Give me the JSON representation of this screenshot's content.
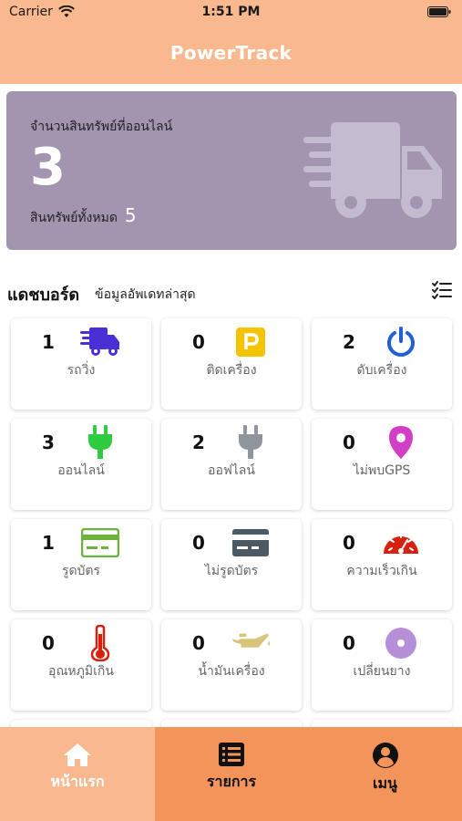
{
  "status_bar": {
    "carrier": "Carrier",
    "time": "1:51 PM"
  },
  "header": {
    "title": "PowerTrack"
  },
  "summary": {
    "online_label": "จำนวนสินทรัพย์ที่ออนไลน์",
    "online_count": "3",
    "total_label": "สินทรัพย์ทั้งหมด",
    "total_count": "5"
  },
  "dashboard": {
    "title": "แดชบอร์ด",
    "subtitle": "ข้อมูลอัพเดทล่าสุด",
    "tiles": [
      {
        "count": "1",
        "label": "รถวิ่ง",
        "icon": "moving-truck-icon",
        "color": "#4a2fd6"
      },
      {
        "count": "0",
        "label": "ติดเครื่อง",
        "icon": "parking-icon",
        "color": "#f5c400"
      },
      {
        "count": "2",
        "label": "ดับเครื่อง",
        "icon": "power-icon",
        "color": "#1f5fd0"
      },
      {
        "count": "3",
        "label": "ออนไลน์",
        "icon": "plug-online-icon",
        "color": "#2ecc40"
      },
      {
        "count": "2",
        "label": "ออฟไลน์",
        "icon": "plug-offline-icon",
        "color": "#8e959c"
      },
      {
        "count": "0",
        "label": "ไม่พบGPS",
        "icon": "map-pin-icon",
        "color": "#d23fc6"
      },
      {
        "count": "1",
        "label": "รูดบัตร",
        "icon": "card-icon",
        "color": "#6bb33a"
      },
      {
        "count": "0",
        "label": "ไม่รูดบัตร",
        "icon": "card-dark-icon",
        "color": "#4c5a66"
      },
      {
        "count": "0",
        "label": "ความเร็วเกิน",
        "icon": "speedometer-icon",
        "color": "#d8200e"
      },
      {
        "count": "0",
        "label": "อุณหภูมิเกิน",
        "icon": "thermometer-icon",
        "color": "#d8200e"
      },
      {
        "count": "0",
        "label": "น้ำมันเครื่อง",
        "icon": "oil-can-icon",
        "color": "#d9c47a"
      },
      {
        "count": "0",
        "label": "เปลี่ยนยาง",
        "icon": "tire-icon",
        "color": "#b58fd8"
      }
    ]
  },
  "nav": {
    "home": "หน้าแรก",
    "list": "รายการ",
    "menu": "เมนู"
  },
  "colors": {
    "header_bg": "#f9b88e",
    "summary_bg": "#a394b0",
    "nav_active": "#f9b88e",
    "nav_inactive": "#f3955b"
  }
}
